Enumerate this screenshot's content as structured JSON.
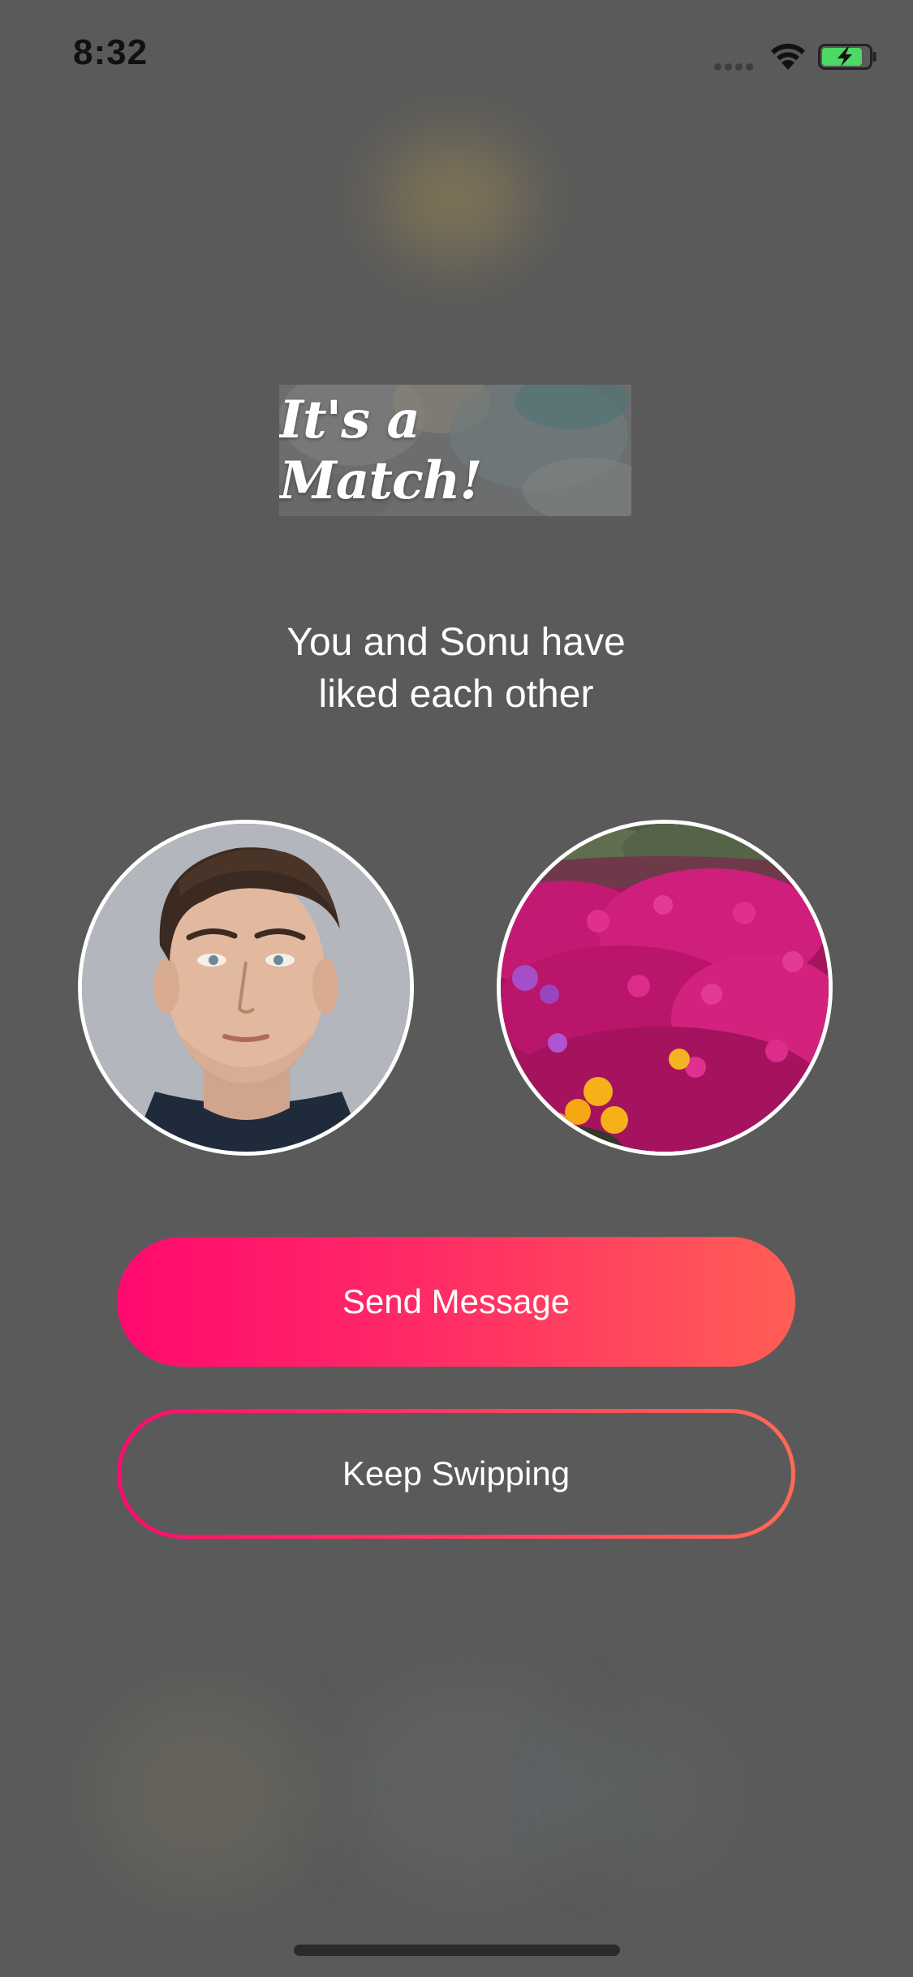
{
  "status_bar": {
    "time": "8:32"
  },
  "match_banner": {
    "title": "It's a Match!"
  },
  "match_message": {
    "line1": "You and Sonu have",
    "line2": "liked each other"
  },
  "avatars": {
    "left_icon": "user-photo",
    "right_icon": "flower-photo"
  },
  "buttons": {
    "send_message": "Send Message",
    "keep_swipping": "Keep Swipping"
  },
  "colors": {
    "background": "#5a5a5a",
    "accent_start": "#ff0a6f",
    "accent_end": "#ff5e55",
    "text": "#ffffff"
  }
}
